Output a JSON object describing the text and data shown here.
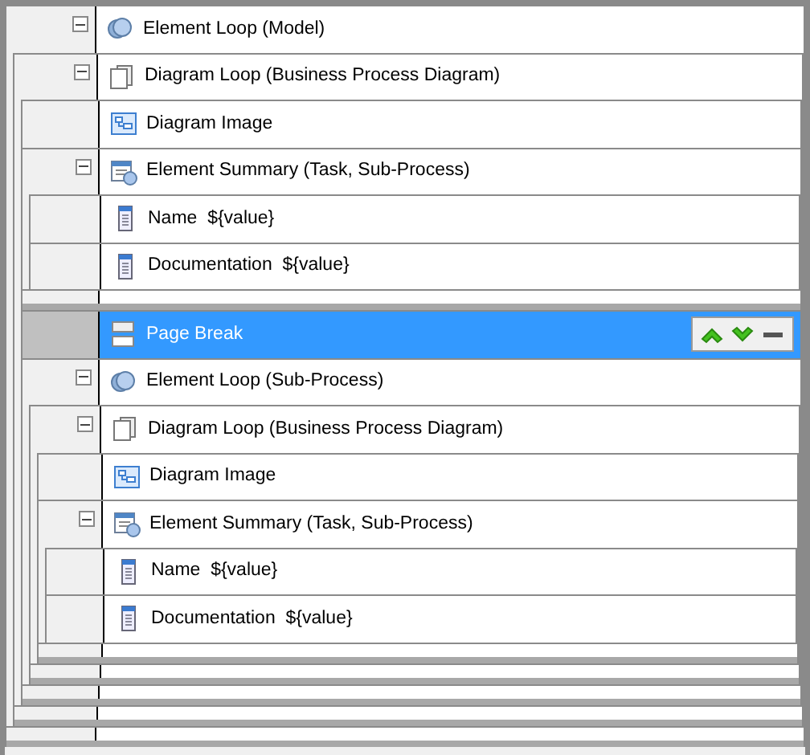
{
  "tree": [
    {
      "kind": "element-loop",
      "label": "Element Loop (Model)",
      "expanded": true,
      "selected": false,
      "children": [
        {
          "kind": "diagram-loop",
          "label": "Diagram Loop (Business Process Diagram)",
          "expanded": true,
          "selected": false,
          "children": [
            {
              "kind": "diagram-image",
              "label": "Diagram Image",
              "selected": false
            },
            {
              "kind": "element-summary",
              "label": "Element Summary (Task, Sub-Process)",
              "expanded": true,
              "selected": false,
              "children": [
                {
                  "kind": "field",
                  "label": "Name  ${value}",
                  "selected": false
                },
                {
                  "kind": "field",
                  "label": "Documentation  ${value}",
                  "selected": false
                }
              ]
            },
            {
              "kind": "page-break",
              "label": "Page Break",
              "selected": true
            },
            {
              "kind": "element-loop",
              "label": "Element Loop (Sub-Process)",
              "expanded": true,
              "selected": false,
              "children": [
                {
                  "kind": "diagram-loop",
                  "label": "Diagram Loop (Business Process Diagram)",
                  "expanded": true,
                  "selected": false,
                  "children": [
                    {
                      "kind": "diagram-image",
                      "label": "Diagram Image",
                      "selected": false
                    },
                    {
                      "kind": "element-summary",
                      "label": "Element Summary (Task, Sub-Process)",
                      "expanded": true,
                      "selected": false,
                      "children": [
                        {
                          "kind": "field",
                          "label": "Name  ${value}",
                          "selected": false
                        },
                        {
                          "kind": "field",
                          "label": "Documentation  ${value}",
                          "selected": false
                        }
                      ]
                    }
                  ]
                }
              ]
            }
          ]
        }
      ]
    }
  ]
}
